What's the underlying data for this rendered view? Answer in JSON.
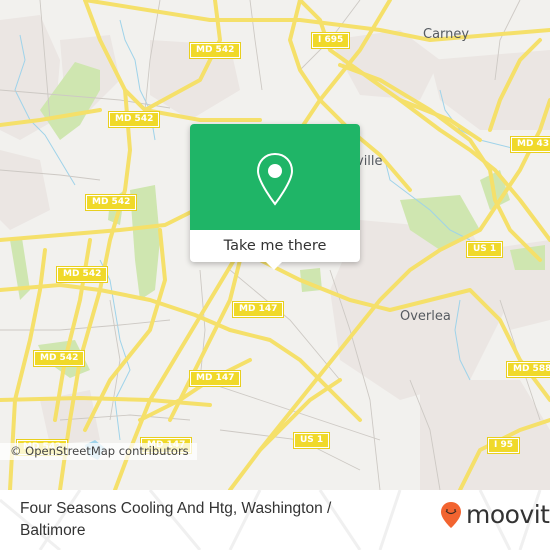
{
  "map": {
    "colors": {
      "background": "#f2f1ee",
      "urban": "#ebe6e3",
      "park": "#cfe6b0",
      "water": "#9fd3ea",
      "major_road": "#f5e06a",
      "minor_road": "#c9c5c0"
    },
    "place_labels": [
      {
        "name": "carney",
        "text": "Carney"
      },
      {
        "name": "parkville",
        "text": "ville"
      },
      {
        "name": "overlea",
        "text": "Overlea"
      }
    ],
    "road_shields": [
      {
        "name": "md-542-north",
        "text": "MD 542"
      },
      {
        "name": "i-695",
        "text": "I 695"
      },
      {
        "name": "md-542-upper",
        "text": "MD 542"
      },
      {
        "name": "md-43",
        "text": "MD 43"
      },
      {
        "name": "md-542-mid",
        "text": "MD 542"
      },
      {
        "name": "us-1-north",
        "text": "US 1"
      },
      {
        "name": "md-542-west",
        "text": "MD 542"
      },
      {
        "name": "md-147-north",
        "text": "MD 147"
      },
      {
        "name": "md-542-southwest",
        "text": "MD 542"
      },
      {
        "name": "md-588",
        "text": "MD 588"
      },
      {
        "name": "md-147-mid",
        "text": "MD 147"
      },
      {
        "name": "md-542-south",
        "text": "MD 542"
      },
      {
        "name": "md-147-south",
        "text": "MD 147"
      },
      {
        "name": "us-1-south",
        "text": "US 1"
      },
      {
        "name": "i-95",
        "text": "I 95"
      }
    ],
    "attribution": "© OpenStreetMap contributors"
  },
  "popup": {
    "icon": "map-pin-icon",
    "button_label": "Take me there",
    "color": "#1fb567"
  },
  "footer": {
    "title": "Four Seasons Cooling And Htg, Washington / Baltimore",
    "logo_text": "moovit",
    "logo_color": "#f26430"
  }
}
